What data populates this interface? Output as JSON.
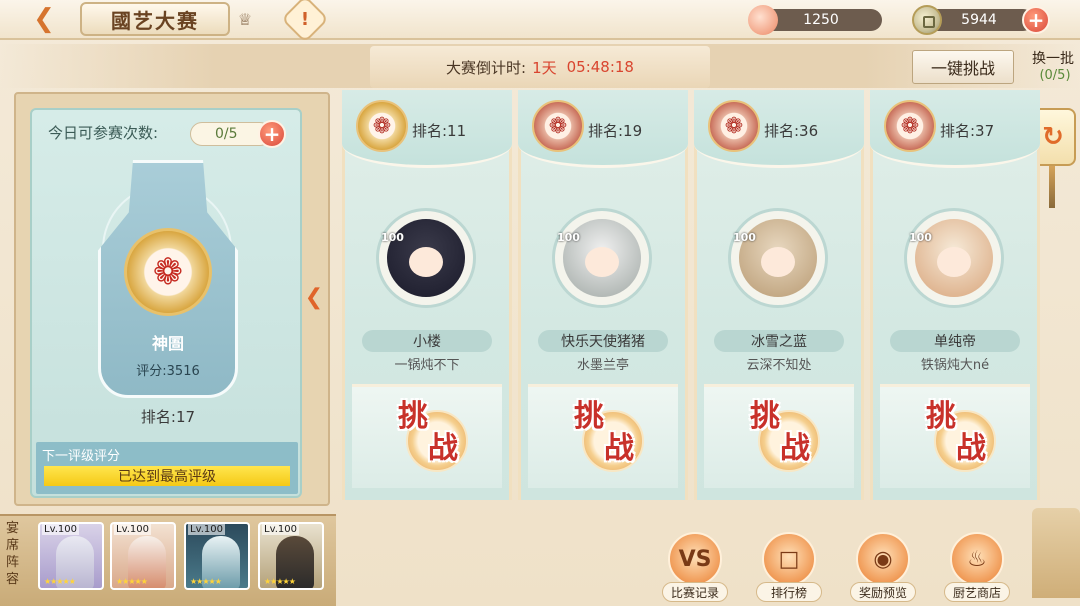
{
  "header": {
    "title": "國艺大赛",
    "back_icon": "back-arrow-icon",
    "crown_icon": "crown-icon",
    "info_icon": "exclamation-icon"
  },
  "currency": {
    "peach": "1250",
    "coins": "5944"
  },
  "timer": {
    "label": "大赛倒计时:",
    "days": "1天",
    "time": "05:48:18"
  },
  "actions": {
    "one_key_challenge": "一键挑战",
    "swap_label": "换一批",
    "swap_count": "(0/5)"
  },
  "player": {
    "today_label": "今日可参赛次数:",
    "today_count": "0/5",
    "grade_name": "神圄",
    "score": "评分:3516",
    "rank": "排名:17",
    "next_grade_label": "下一评级评分",
    "max_grade_text": "已达到最高评级"
  },
  "team": {
    "label": "宴席阵容",
    "heroes": [
      {
        "level": "Lv.100",
        "stars": "★★★★★"
      },
      {
        "level": "Lv.100",
        "stars": "★★★★★"
      },
      {
        "level": "Lv.100",
        "stars": "★★★★★"
      },
      {
        "level": "Lv.100",
        "stars": "★★★★★"
      }
    ]
  },
  "opponents": [
    {
      "rank": "排名:11",
      "level": "100",
      "name": "小楼",
      "guild": "一锅炖不下",
      "challenge_top": "挑",
      "challenge_bottom": "战"
    },
    {
      "rank": "排名:19",
      "level": "100",
      "name": "快乐天使猪猪",
      "guild": "水墨兰亭",
      "challenge_top": "挑",
      "challenge_bottom": "战"
    },
    {
      "rank": "排名:36",
      "level": "100",
      "name": "冰雪之蓝",
      "guild": "云深不知处",
      "challenge_top": "挑",
      "challenge_bottom": "战"
    },
    {
      "rank": "排名:37",
      "level": "100",
      "name": "单纯帝",
      "guild": "铁锅炖大né",
      "challenge_top": "挑",
      "challenge_bottom": "战"
    }
  ],
  "bottom_buttons": [
    {
      "label": "比赛记录",
      "icon": "vs-record-icon"
    },
    {
      "label": "排行榜",
      "icon": "podium-icon"
    },
    {
      "label": "奖励预览",
      "icon": "reward-icon"
    },
    {
      "label": "厨艺商店",
      "icon": "shop-icon"
    }
  ],
  "colors": {
    "accent_red": "#d9452f",
    "panel_teal": "#c5e0dc",
    "frame_tan": "#e7d4b1"
  }
}
